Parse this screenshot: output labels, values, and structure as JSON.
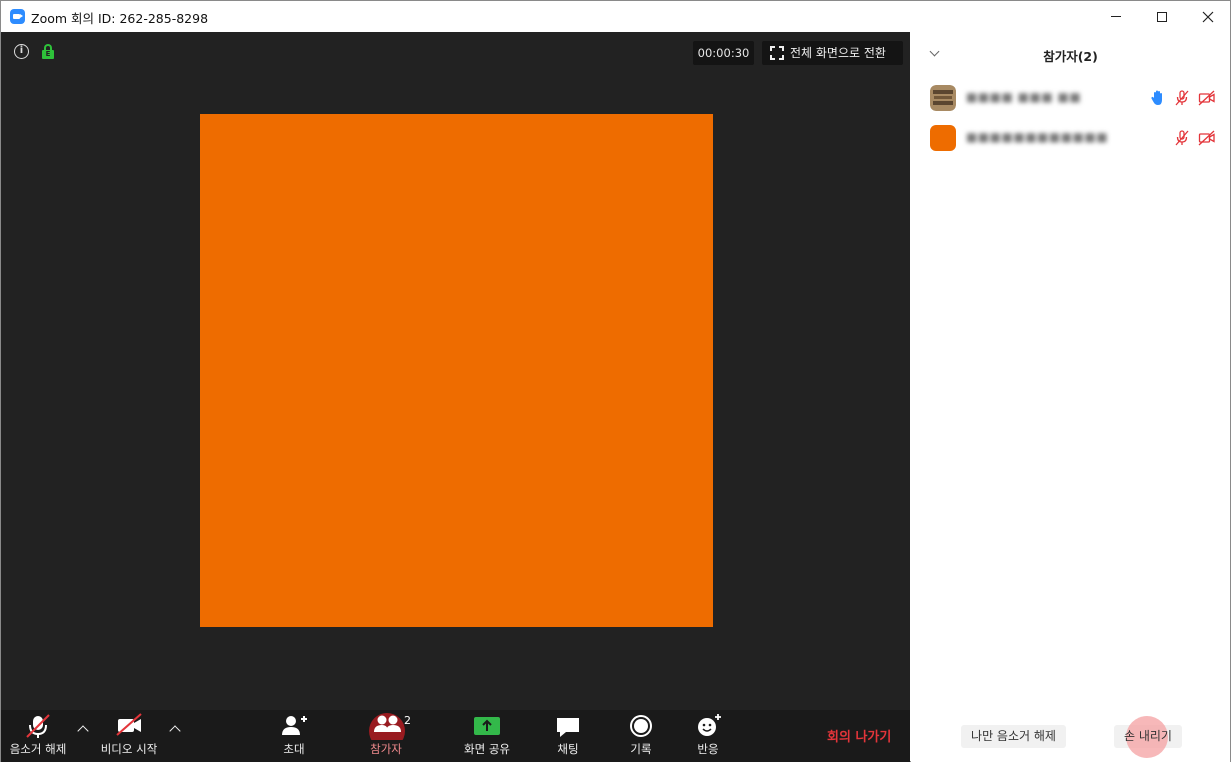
{
  "window": {
    "title": "Zoom 회의 ID: 262-285-8298"
  },
  "meeting": {
    "timer": "00:00:30",
    "fullscreen_label": "전체 화면으로 전환",
    "lock_badge": "E",
    "tile_color": "#ee6c00"
  },
  "toolbar": {
    "unmute_label": "음소거 해제",
    "video_label": "비디오 시작",
    "invite_label": "초대",
    "participants_label": "참가자",
    "participants_count": "2",
    "share_label": "화면 공유",
    "chat_label": "채팅",
    "record_label": "기록",
    "reactions_label": "반응",
    "leave_label": "회의 나가기"
  },
  "panel": {
    "title": "참가자(2)",
    "participants": [
      {
        "name": "■■■■ ■■■ ■■",
        "avatar": "photo",
        "hand_raised": true,
        "muted": true,
        "video_off": true
      },
      {
        "name": "■■■■■■■■■■■■",
        "avatar_color": "#ee6c00",
        "hand_raised": false,
        "muted": true,
        "video_off": true
      }
    ],
    "mute_me_label": "나만 음소거 해제",
    "lower_hand_label": "손 내리기"
  },
  "colors": {
    "accent": "#2d8cff",
    "muted_red": "#e3353a",
    "share_green": "#33b84a",
    "hand_blue": "#2d8cff"
  }
}
